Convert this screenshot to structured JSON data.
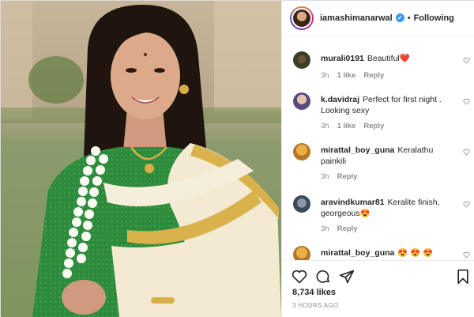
{
  "header": {
    "username": "iamashimanarwal",
    "separator": "•",
    "follow_label": "Following"
  },
  "comments": [
    {
      "username": "murali0191",
      "text": "Beautiful❤️",
      "time": "3h",
      "likes": "1 like",
      "reply": "Reply"
    },
    {
      "username": "k.davidraj",
      "text": "Perfect for first night . Looking sexy",
      "time": "3h",
      "likes": "1 like",
      "reply": "Reply"
    },
    {
      "username": "mirattal_boy_guna",
      "text": "Keralathu painkili",
      "time": "3h",
      "likes": "",
      "reply": "Reply"
    },
    {
      "username": "aravindkumar81",
      "text": "Keralite finish, georgeous😍",
      "time": "3h",
      "likes": "",
      "reply": "Reply"
    },
    {
      "username": "mirattal_boy_guna",
      "text": "😍 😍 😍",
      "time": "",
      "likes": "",
      "reply": ""
    }
  ],
  "footer": {
    "likes": "8,734 likes",
    "time": "3 HOURS AGO"
  },
  "icons": {
    "verified": "verified-badge",
    "heart": "heart-icon",
    "comment": "comment-icon",
    "share": "share-icon",
    "bookmark": "bookmark-icon"
  },
  "colors": {
    "verified": "#3897f0",
    "muted": "#8e8e8e",
    "text": "#262626",
    "saree_gold": "#d9b24c",
    "blouse_green": "#2e8a3c"
  }
}
